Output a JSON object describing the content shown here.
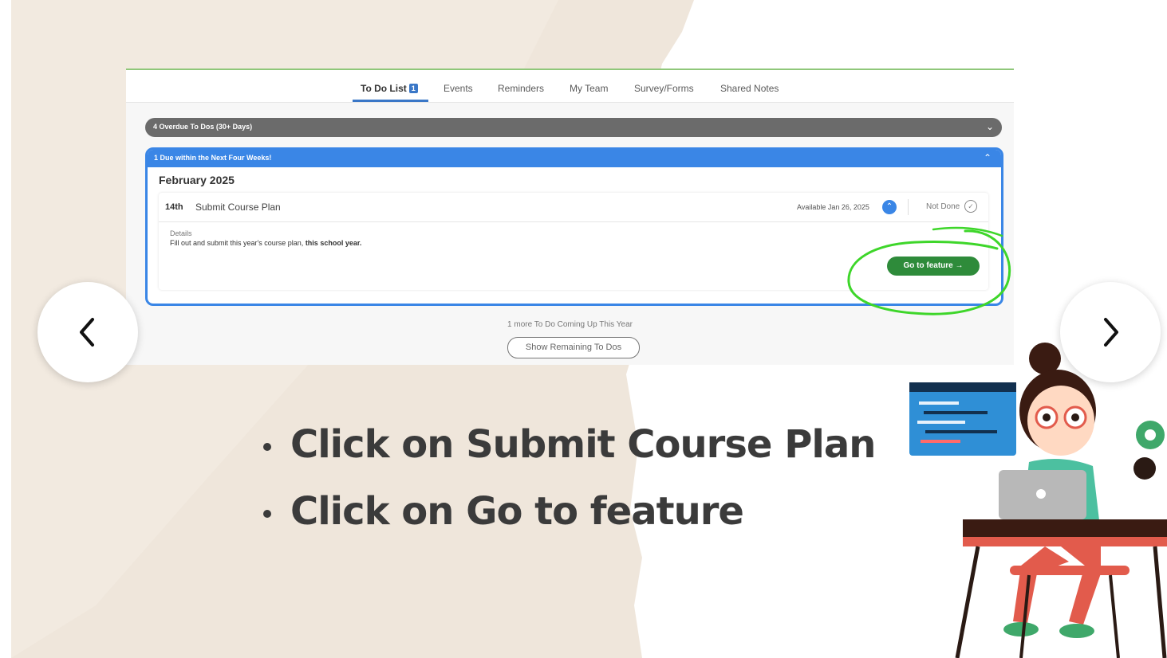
{
  "tabs": {
    "todo": "To Do List",
    "todo_badge": "1",
    "events": "Events",
    "reminders": "Reminders",
    "my_team": "My Team",
    "survey": "Survey/Forms",
    "shared_notes": "Shared Notes"
  },
  "overdue": {
    "label": "4 Overdue To Dos (30+ Days)"
  },
  "due": {
    "label": "1 Due within the Next Four Weeks!",
    "month": "February 2025",
    "item": {
      "day": "14th",
      "title": "Submit Course Plan",
      "available": "Available Jan 26, 2025",
      "status": "Not Done",
      "details_label": "Details",
      "details_text": "Fill out and submit this year's course plan,",
      "details_bold": "this school year.",
      "go_button": "Go to feature →"
    }
  },
  "more": {
    "text": "1 more To Do Coming Up This Year",
    "button": "Show Remaining To Dos"
  },
  "instructions": [
    "Click on Submit Course Plan",
    "Click on Go to feature"
  ],
  "colors": {
    "accent_blue": "#3a86e6",
    "go_green": "#2e8b3a",
    "annotation_green": "#3ed62a",
    "overdue_gray": "#6b6b6b",
    "text_dark": "#3b3b3b"
  },
  "icons": {
    "prev": "chevron-left-icon",
    "next": "chevron-right-icon",
    "collapse": "chevron-up-icon",
    "expand": "chevron-down-icon",
    "status": "check-circle-icon"
  }
}
